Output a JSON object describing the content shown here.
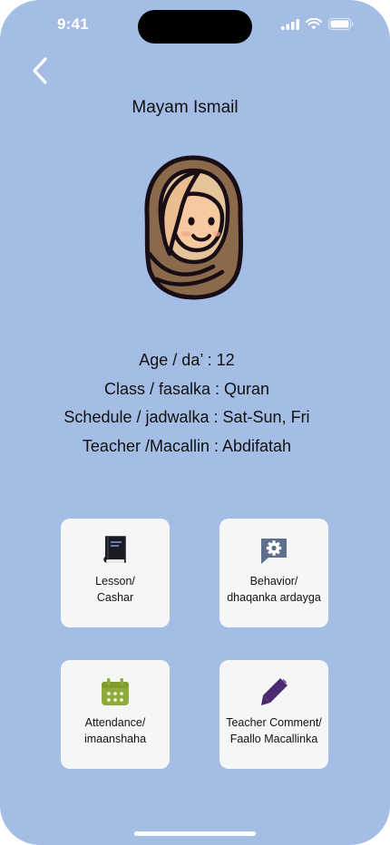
{
  "status_bar": {
    "time": "9:41"
  },
  "profile": {
    "name": "Mayam Ismail",
    "details": [
      "Age / da’ : 12",
      "Class / fasalka : Quran",
      "Schedule / jadwalka : Sat-Sun, Fri",
      "Teacher /Macallin : Abdifatah"
    ]
  },
  "cards": {
    "lesson": {
      "line1": "Lesson/",
      "line2": "Cashar",
      "icon": "book-icon"
    },
    "behavior": {
      "line1": "Behavior/",
      "line2": "dhaqanka ardayga",
      "icon": "chat-gear-icon"
    },
    "attendance": {
      "line1": "Attendance/",
      "line2": "imaanshaha",
      "icon": "calendar-icon"
    },
    "comment": {
      "line1": "Teacher Comment/",
      "line2": "Faallo Macallinka",
      "icon": "pen-icon"
    }
  },
  "colors": {
    "background": "#a3bde4",
    "card": "#f5f7f6",
    "calendar_accent": "#8fab3a",
    "pen_accent": "#4b2a73",
    "chat_icon": "#5f6f8c"
  }
}
